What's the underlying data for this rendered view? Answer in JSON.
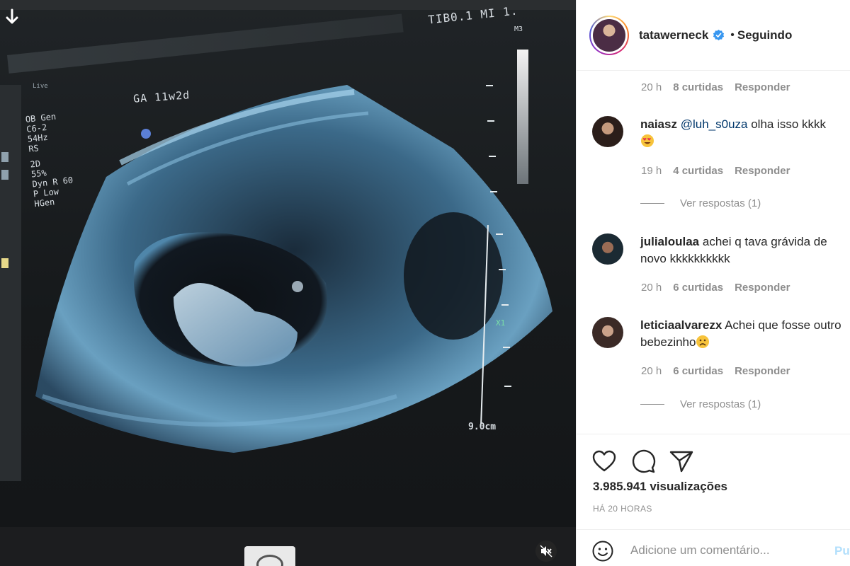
{
  "post": {
    "username": "tatawerneck",
    "follow_status": "Seguindo",
    "separator": "•"
  },
  "media": {
    "overlay": {
      "ga": "GA 11w2d",
      "tib": "TIB0.1  MI 1.",
      "m3": "M3",
      "live": "Live",
      "settings": [
        "OB Gen",
        "C6-2",
        "54Hz",
        "RS",
        "",
        "2D",
        "55%",
        "Dyn R 60",
        "P Low",
        "HGen"
      ],
      "scale": "9.0cm",
      "x1": "X1"
    }
  },
  "comments": {
    "top_meta": {
      "time": "20 h",
      "likes": "8 curtidas",
      "reply": "Responder"
    },
    "items": [
      {
        "user": "naiasz",
        "mention": "@luh_s0uza",
        "text": " olha isso kkkk",
        "time": "19 h",
        "likes": "4 curtidas",
        "reply": "Responder",
        "view_replies": "Ver respostas (1)"
      },
      {
        "user": "julialoulaa",
        "text": " achei q tava grávida de novo kkkkkkkkkk",
        "time": "20 h",
        "likes": "6 curtidas",
        "reply": "Responder"
      },
      {
        "user": "leticiaalvarezx",
        "text": " Achei que fosse outro bebezinho",
        "time": "20 h",
        "likes": "6 curtidas",
        "reply": "Responder",
        "view_replies": "Ver respostas (1)"
      }
    ]
  },
  "stats": {
    "views": "3.985.941 visualizações",
    "time_ago": "HÁ 20 HORAS"
  },
  "comment_box": {
    "placeholder": "Adicione um comentário...",
    "publish": "Pu"
  },
  "icons": {
    "download": "arrow-down-icon",
    "mute": "speaker-muted-icon",
    "like": "heart-icon",
    "comment": "comment-bubble-icon",
    "share": "paper-plane-icon",
    "emoji": "smiley-icon",
    "verified": "verified-badge-icon"
  },
  "colors": {
    "verified": "#3897f0",
    "link": "#00376b",
    "meta": "#8e8e8e",
    "publish": "#b2dffc"
  }
}
